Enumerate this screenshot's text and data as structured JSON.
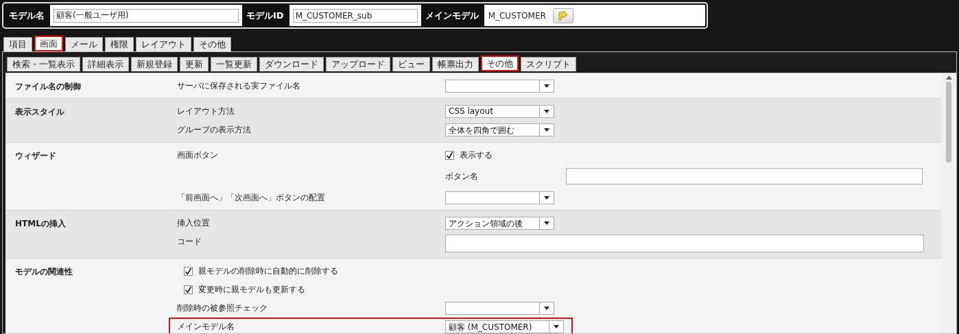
{
  "header": {
    "fields": [
      {
        "kind": "input",
        "label": "モデル名",
        "value": "顧客(一般ユーザ用)"
      },
      {
        "kind": "input",
        "label": "モデルID",
        "value": "M_CUSTOMER_sub"
      },
      {
        "kind": "link",
        "label": "メインモデル",
        "value": "M_CUSTOMER"
      }
    ]
  },
  "main_tabs": [
    {
      "label": "項目",
      "selected": false,
      "highlighted": false
    },
    {
      "label": "画面",
      "selected": true,
      "highlighted": true
    },
    {
      "label": "メール",
      "selected": false,
      "highlighted": false
    },
    {
      "label": "権限",
      "selected": false,
      "highlighted": false
    },
    {
      "label": "レイアウト",
      "selected": false,
      "highlighted": false
    },
    {
      "label": "その他",
      "selected": false,
      "highlighted": false
    }
  ],
  "sub_tabs": [
    {
      "label": "検索・一覧表示",
      "selected": false,
      "highlighted": false
    },
    {
      "label": "詳細表示",
      "selected": false,
      "highlighted": false
    },
    {
      "label": "新規登録",
      "selected": false,
      "highlighted": false
    },
    {
      "label": "更新",
      "selected": false,
      "highlighted": false
    },
    {
      "label": "一覧更新",
      "selected": false,
      "highlighted": false
    },
    {
      "label": "ダウンロード",
      "selected": false,
      "highlighted": false
    },
    {
      "label": "アップロード",
      "selected": false,
      "highlighted": false
    },
    {
      "label": "ビュー",
      "selected": false,
      "highlighted": false
    },
    {
      "label": "帳票出力",
      "selected": false,
      "highlighted": false
    },
    {
      "label": "その他",
      "selected": true,
      "highlighted": true
    },
    {
      "label": "スクリプト",
      "selected": false,
      "highlighted": false
    }
  ],
  "sections": [
    {
      "title": "ファイル名の制御",
      "items": [
        {
          "kind": "select",
          "label": "サーバに保存される実ファイル名",
          "highlighted": false
        }
      ]
    },
    {
      "title": "表示スタイル",
      "items": [
        {
          "kind": "select",
          "label": "レイアウト方法",
          "value": "CSS layout",
          "highlighted": false
        },
        {
          "kind": "select",
          "label": "グループの表示方法",
          "value": "全体を四角で囲む",
          "highlighted": false
        }
      ]
    },
    {
      "title": "ウィザード",
      "items": [
        {
          "kind": "checkbox",
          "label": "画面ボタン",
          "option": "表示する",
          "checked": true
        },
        {
          "kind": "labeled-field",
          "label": "ボタン名"
        },
        {
          "kind": "select",
          "label": "「前画面へ」「次画面へ」ボタンの配置",
          "highlighted": false
        }
      ]
    },
    {
      "title": "HTMLの挿入",
      "items": [
        {
          "kind": "select",
          "label": "挿入位置",
          "value": "アクション領域の後",
          "highlighted": false
        },
        {
          "kind": "text-field",
          "label": "コード"
        }
      ]
    },
    {
      "title": "モデルの関連性",
      "items": [
        {
          "kind": "checkbox",
          "option": "親モデルの削除時に自動的に削除する",
          "checked": true
        },
        {
          "kind": "checkbox",
          "option": "変更時に親モデルも更新する",
          "checked": true
        },
        {
          "kind": "select",
          "label": "削除時の被参照チェック",
          "highlighted": false
        },
        {
          "kind": "select",
          "label": "メインモデル名",
          "value": "顧客 (M_CUSTOMER)",
          "highlighted": true
        }
      ]
    }
  ]
}
